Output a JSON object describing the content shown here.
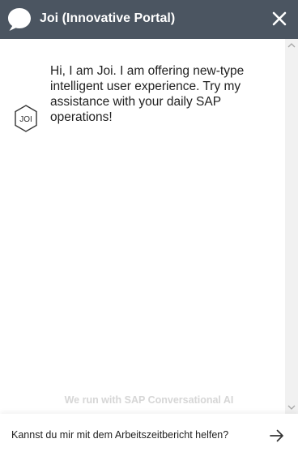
{
  "header": {
    "title": "Joi (Innovative Portal)",
    "logo_icon": "chat-bubble-icon",
    "close_icon": "close-icon",
    "background": "#4b5561"
  },
  "messages": [
    {
      "sender": "bot",
      "avatar_text": "JOI",
      "text": "Hi, I am Joi. I am offering new-type intelligent user experience. Try my assistance with your daily SAP operations!"
    }
  ],
  "branding": {
    "text": "We run with SAP Conversational AI"
  },
  "input": {
    "value": "Kannst du mir mit dem Arbeitszeitbericht helfen?",
    "send_icon": "arrow-right-icon"
  },
  "scrollbar": {
    "up_icon": "scroll-up-icon",
    "down_icon": "scroll-down-icon"
  }
}
